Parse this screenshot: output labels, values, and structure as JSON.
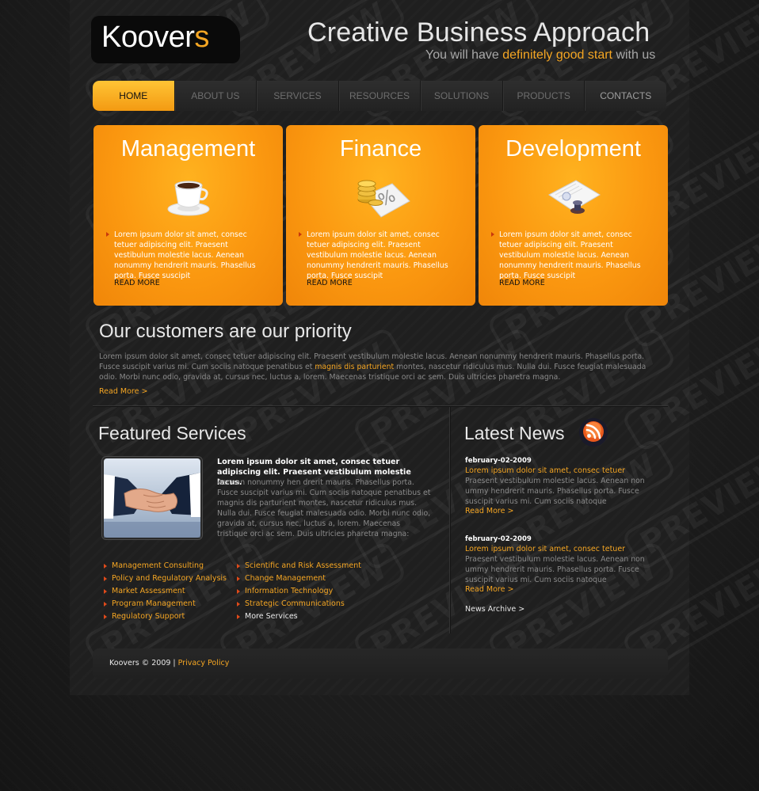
{
  "header": {
    "logo_main": "Koover",
    "logo_accent": "s",
    "slogan_title": "Creative Business Approach",
    "slogan_pre": "You will have ",
    "slogan_highlight": "definitely good start",
    "slogan_post": " with us"
  },
  "nav": {
    "items": [
      "HOME",
      "ABOUT US",
      "SERVICES",
      "RESOURCES",
      "SOLUTIONS",
      "PRODUCTS",
      "CONTACTS"
    ]
  },
  "boxes": [
    {
      "title": "Management",
      "icon": "coffee-cup-icon",
      "text": "Lorem ipsum dolor sit amet, consec tetuer adipiscing elit. Praesent vestibulum molestie lacus. Aenean nonummy hendrerit mauris. Phasellus porta. Fusce suscipit",
      "more": "READ MORE"
    },
    {
      "title": "Finance",
      "icon": "coins-icon",
      "text": "Lorem ipsum dolor sit amet, consec tetuer adipiscing elit. Praesent vestibulum molestie lacus. Aenean nonummy hendrerit mauris. Phasellus porta. Fusce suscipit",
      "more": "READ MORE"
    },
    {
      "title": "Development",
      "icon": "document-stamp-icon",
      "text": "Lorem ipsum dolor sit amet, consec tetuer adipiscing elit. Praesent vestibulum molestie lacus. Aenean nonummy hendrerit mauris. Phasellus porta. Fusce suscipit",
      "more": "READ MORE"
    }
  ],
  "priority": {
    "title": "Our customers are our priority",
    "text_pre": "Lorem ipsum dolor sit amet, consec tetuer adipiscing elit. Praesent vestibulum molestie lacus. Aenean nonummy hendrerit mauris. Phasellus porta. Fusce suscipit varius mi. Cum sociis natoque penatibus et ",
    "text_link": "magnis dis parturient",
    "text_post": " montes, nascetur ridiculus mus. Nulla dui. Fusce feugiat malesuada odio. Morbi nunc odio, gravida at, cursus nec, luctus a, lorem. Maecenas tristique orci ac sem. Duis ultricies pharetra magna.",
    "read_more": "Read More >"
  },
  "featured": {
    "title": "Featured Services",
    "image": "handshake-photo",
    "lead": "Lorem ipsum dolor sit amet, consec tetuer adipiscing elit. Praesent vestibulum molestie lacus.",
    "text": "Aenean nonummy hen drerit mauris. Phasellus porta. Fusce suscipit varius mi. Cum sociis natoque penatibus et magnis dis parturient montes, nascetur ridiculus mus. Nulla dui. Fusce feugiat malesuada odio. Morbi nunc odio, gravida at, cursus nec, luctus a, lorem. Maecenas tristique orci ac sem. Duis ultricies pharetra magna:",
    "list_left": [
      "Management Consulting",
      "Policy and Regulatory Analysis",
      "Market Assessment",
      "Program Management",
      "Regulatory Support"
    ],
    "list_right": [
      "Scientific and Risk Assessment",
      "Change Management",
      "Information Technology",
      "Strategic Communications",
      "More Services"
    ]
  },
  "news": {
    "title": "Latest News",
    "icon": "rss-icon",
    "items": [
      {
        "date": "february-02-2009",
        "title": "Lorem ipsum dolor sit amet, consec tetuer",
        "text": "Praesent vestibulum molestie lacus. Aenean non ummy hendrerit mauris. Phasellus porta. Fusce suscipit varius mi. Cum sociis natoque",
        "more": "Read More >"
      },
      {
        "date": "february-02-2009",
        "title": "Lorem ipsum dolor sit amet, consec tetuer",
        "text": "Praesent vestibulum molestie lacus. Aenean non ummy hendrerit mauris. Phasellus porta. Fusce suscipit varius mi. Cum sociis natoque",
        "more": "Read More >"
      }
    ],
    "archive": "News Archive >"
  },
  "footer": {
    "copyright": "Koovers © 2009",
    "separator": "|",
    "privacy": "Privacy Policy"
  },
  "watermark": "PREVIEW",
  "colors": {
    "accent": "#f5a623",
    "background": "#1f1f1f",
    "box_orange": "#fb9810"
  }
}
